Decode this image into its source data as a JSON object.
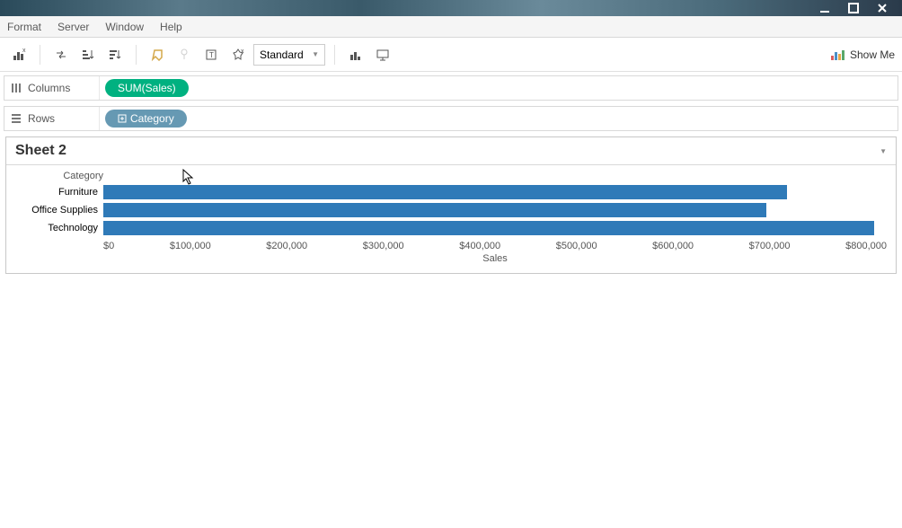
{
  "menubar": {
    "items": [
      "Format",
      "Server",
      "Window",
      "Help"
    ]
  },
  "toolbar": {
    "fit_label": "Standard",
    "showme_label": "Show Me"
  },
  "shelves": {
    "columns_label": "Columns",
    "rows_label": "Rows",
    "columns_pill": "SUM(Sales)",
    "rows_pill": "Category"
  },
  "sheet": {
    "title": "Sheet 2"
  },
  "chart_data": {
    "type": "bar",
    "category_header": "Category",
    "categories": [
      "Furniture",
      "Office Supplies",
      "Technology"
    ],
    "values": [
      742000,
      719000,
      836000
    ],
    "xlabel": "Sales",
    "xlim": [
      0,
      850000
    ],
    "ticks": [
      "$0",
      "$100,000",
      "$200,000",
      "$300,000",
      "$400,000",
      "$500,000",
      "$600,000",
      "$700,000",
      "$800,000"
    ]
  }
}
